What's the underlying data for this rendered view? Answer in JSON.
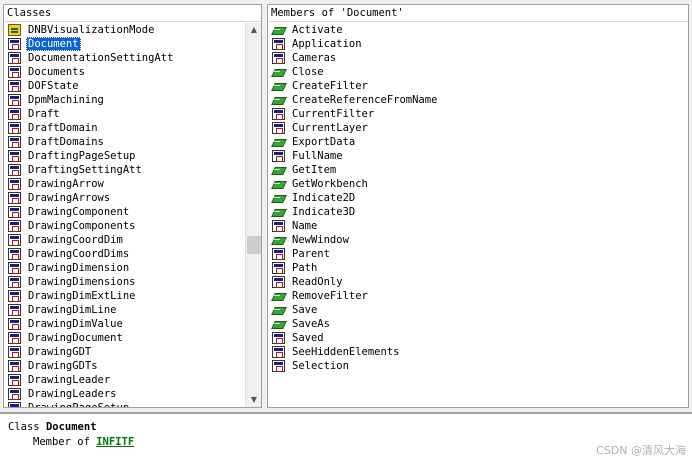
{
  "classes": {
    "header": "Classes",
    "items": [
      {
        "name": "DNBVisualizationMode",
        "icon": "enum-icon",
        "selected": false
      },
      {
        "name": "Document",
        "icon": "class-icon",
        "selected": true
      },
      {
        "name": "DocumentationSettingAtt",
        "icon": "class-icon",
        "selected": false
      },
      {
        "name": "Documents",
        "icon": "class-icon",
        "selected": false
      },
      {
        "name": "DOFState",
        "icon": "class-icon",
        "selected": false
      },
      {
        "name": "DpmMachining",
        "icon": "class-icon",
        "selected": false
      },
      {
        "name": "Draft",
        "icon": "class-icon",
        "selected": false
      },
      {
        "name": "DraftDomain",
        "icon": "class-icon",
        "selected": false
      },
      {
        "name": "DraftDomains",
        "icon": "class-icon",
        "selected": false
      },
      {
        "name": "DraftingPageSetup",
        "icon": "class-icon",
        "selected": false
      },
      {
        "name": "DraftingSettingAtt",
        "icon": "class-icon",
        "selected": false
      },
      {
        "name": "DrawingArrow",
        "icon": "class-icon",
        "selected": false
      },
      {
        "name": "DrawingArrows",
        "icon": "class-icon",
        "selected": false
      },
      {
        "name": "DrawingComponent",
        "icon": "class-icon",
        "selected": false
      },
      {
        "name": "DrawingComponents",
        "icon": "class-icon",
        "selected": false
      },
      {
        "name": "DrawingCoordDim",
        "icon": "class-icon",
        "selected": false
      },
      {
        "name": "DrawingCoordDims",
        "icon": "class-icon",
        "selected": false
      },
      {
        "name": "DrawingDimension",
        "icon": "class-icon",
        "selected": false
      },
      {
        "name": "DrawingDimensions",
        "icon": "class-icon",
        "selected": false
      },
      {
        "name": "DrawingDimExtLine",
        "icon": "class-icon",
        "selected": false
      },
      {
        "name": "DrawingDimLine",
        "icon": "class-icon",
        "selected": false
      },
      {
        "name": "DrawingDimValue",
        "icon": "class-icon",
        "selected": false
      },
      {
        "name": "DrawingDocument",
        "icon": "class-icon",
        "selected": false
      },
      {
        "name": "DrawingGDT",
        "icon": "class-icon",
        "selected": false
      },
      {
        "name": "DrawingGDTs",
        "icon": "class-icon",
        "selected": false
      },
      {
        "name": "DrawingLeader",
        "icon": "class-icon",
        "selected": false
      },
      {
        "name": "DrawingLeaders",
        "icon": "class-icon",
        "selected": false
      },
      {
        "name": "DrawingPageSetup",
        "icon": "class-icon",
        "selected": false
      }
    ],
    "scroll_up_icon": "scroll-up-arrow-icon",
    "scroll_down_icon": "scroll-down-arrow-icon"
  },
  "members": {
    "header": "Members of 'Document'",
    "items": [
      {
        "name": "Activate",
        "icon": "method-icon"
      },
      {
        "name": "Application",
        "icon": "property-icon"
      },
      {
        "name": "Cameras",
        "icon": "property-icon"
      },
      {
        "name": "Close",
        "icon": "method-icon"
      },
      {
        "name": "CreateFilter",
        "icon": "method-icon"
      },
      {
        "name": "CreateReferenceFromName",
        "icon": "method-icon"
      },
      {
        "name": "CurrentFilter",
        "icon": "property-icon"
      },
      {
        "name": "CurrentLayer",
        "icon": "property-icon"
      },
      {
        "name": "ExportData",
        "icon": "method-icon"
      },
      {
        "name": "FullName",
        "icon": "property-icon"
      },
      {
        "name": "GetItem",
        "icon": "method-icon"
      },
      {
        "name": "GetWorkbench",
        "icon": "method-icon"
      },
      {
        "name": "Indicate2D",
        "icon": "method-icon"
      },
      {
        "name": "Indicate3D",
        "icon": "method-icon"
      },
      {
        "name": "Name",
        "icon": "property-icon"
      },
      {
        "name": "NewWindow",
        "icon": "method-icon"
      },
      {
        "name": "Parent",
        "icon": "property-icon"
      },
      {
        "name": "Path",
        "icon": "property-icon"
      },
      {
        "name": "ReadOnly",
        "icon": "property-icon"
      },
      {
        "name": "RemoveFilter",
        "icon": "method-icon"
      },
      {
        "name": "Save",
        "icon": "method-icon"
      },
      {
        "name": "SaveAs",
        "icon": "method-icon"
      },
      {
        "name": "Saved",
        "icon": "property-icon"
      },
      {
        "name": "SeeHiddenElements",
        "icon": "property-icon"
      },
      {
        "name": "Selection",
        "icon": "property-icon"
      }
    ]
  },
  "details": {
    "prefix": "Class",
    "class_name": "Document",
    "member_of_text": "Member of",
    "library": "INFITF"
  },
  "watermark": "CSDN @清风大海",
  "colors": {
    "selection": "#0a64d8",
    "library_link": "#007a00"
  }
}
